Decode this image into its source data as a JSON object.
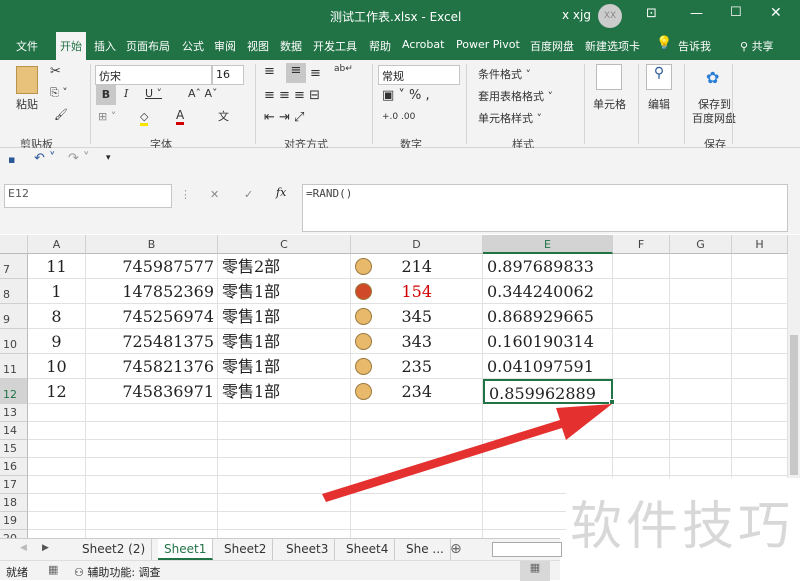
{
  "title": {
    "text": "测试工作表.xlsx  -  Excel",
    "user": "x xjg",
    "avatar": "XX"
  },
  "menu": [
    "文件",
    "开始",
    "插入",
    "页面布局",
    "公式",
    "审阅",
    "视图",
    "数据",
    "开发工具",
    "帮助",
    "Acrobat",
    "Power Pivot",
    "百度网盘",
    "新建选项卡",
    "告诉我",
    "共享"
  ],
  "ribbon": {
    "paste": "粘贴",
    "font_name": "仿宋",
    "font_size": "16",
    "number_format": "常规",
    "cond_format": "条件格式 ˅",
    "table_format": "套用表格格式 ˅",
    "cell_style": "单元格样式 ˅",
    "cells": "单元格",
    "edit": "编辑",
    "save_to": "保存到",
    "baidu": "百度网盘",
    "groups": [
      "剪贴板",
      "字体",
      "对齐方式",
      "数字",
      "样式",
      "保存"
    ]
  },
  "name_box": "E12",
  "formula": "=RAND()",
  "columns": [
    "A",
    "B",
    "C",
    "D",
    "E",
    "F",
    "G",
    "H"
  ],
  "rows": [
    {
      "n": "7",
      "a": "11",
      "b": "745987577",
      "c": "零售2部",
      "dot": "#e8b96a",
      "d": "214",
      "d_red": false,
      "e": "0.897689833"
    },
    {
      "n": "8",
      "a": "1",
      "b": "147852369",
      "c": "零售1部",
      "dot": "#d04a2a",
      "d": "154",
      "d_red": true,
      "e": "0.344240062"
    },
    {
      "n": "9",
      "a": "8",
      "b": "745256974",
      "c": "零售1部",
      "dot": "#e8b96a",
      "d": "345",
      "d_red": false,
      "e": "0.868929665"
    },
    {
      "n": "10",
      "a": "9",
      "b": "725481375",
      "c": "零售1部",
      "dot": "#e8b96a",
      "d": "343",
      "d_red": false,
      "e": "0.160190314"
    },
    {
      "n": "11",
      "a": "10",
      "b": "745821376",
      "c": "零售1部",
      "dot": "#e8b96a",
      "d": "235",
      "d_red": false,
      "e": "0.041097591"
    },
    {
      "n": "12",
      "a": "12",
      "b": "745836971",
      "c": "零售1部",
      "dot": "#e8b96a",
      "d": "234",
      "d_red": false,
      "e": "0.859962889"
    }
  ],
  "empty_rows": [
    "13",
    "14",
    "15",
    "16",
    "17",
    "18",
    "19",
    "20"
  ],
  "sheets": [
    "Sheet2 (2)",
    "Sheet1",
    "Sheet2",
    "Sheet3",
    "Sheet4",
    "She ..."
  ],
  "active_sheet": "Sheet1",
  "status": {
    "ready": "就绪",
    "accessibility": "辅助功能: 调查"
  },
  "watermark": "软件技巧",
  "colors": {
    "excel_green": "#217346",
    "arrow": "#e53030"
  }
}
